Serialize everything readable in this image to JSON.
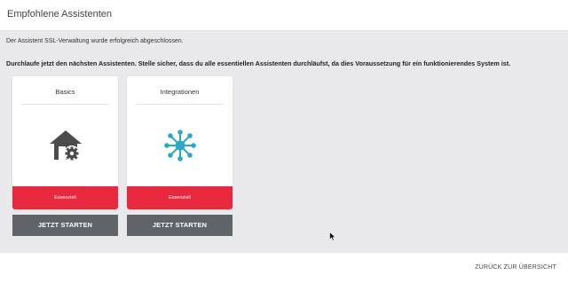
{
  "header": {
    "title": "Empfohlene Assistenten"
  },
  "main": {
    "success_message": "Der Assistent SSL-Verwaltung wurde erfolgreich abgeschlossen.",
    "instruction": "Durchlaufe jetzt den nächsten Assistenten. Stelle sicher, dass du alle essentiellen Assistenten durchläufst, da dies Voraussetzung für ein funktionierendes System ist."
  },
  "cards": [
    {
      "title": "Basics",
      "icon": "house-gear-icon",
      "icon_color": "#4b4b4b",
      "badge": "Essenziell",
      "button": "JETZT STARTEN"
    },
    {
      "title": "Integrationen",
      "icon": "network-hub-icon",
      "icon_color": "#2aa8c9",
      "badge": "Essenziell",
      "button": "JETZT STARTEN"
    }
  ],
  "footer": {
    "back_label": "ZURÜCK ZUR ÜBERSICHT"
  },
  "colors": {
    "badge_red": "#e8283d",
    "button_gray": "#5f6469",
    "content_bg": "#e9e9eb"
  }
}
